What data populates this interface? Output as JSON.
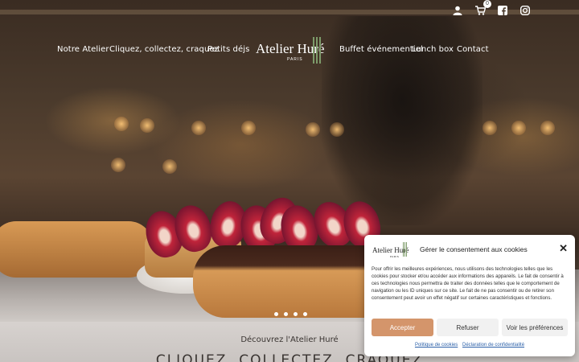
{
  "header": {
    "icons": [
      "user-icon",
      "cart-icon",
      "facebook-icon",
      "instagram-icon"
    ],
    "cart_count": "0"
  },
  "nav": {
    "items": [
      "Notre Atelier",
      "Cliquez, collectez, craquez",
      "Petits déjs",
      "Buffet événementiel",
      "Lunch box",
      "Contact"
    ],
    "logo_name": "Atelier Huré",
    "logo_city": "PARIS"
  },
  "slider": {
    "slide_count": 4,
    "active_index": 0
  },
  "section": {
    "subtitle": "Découvrez l'Atelier Huré",
    "title": "CLIQUEZ, COLLECTEZ, CRAQUEZ"
  },
  "cookie": {
    "logo_name": "Atelier Huré",
    "logo_city": "PARIS",
    "title": "Gérer le consentement aux cookies",
    "body": "Pour offrir les meilleures expériences, nous utilisons des technologies telles que les cookies pour stocker et/ou accéder aux informations des appareils. Le fait de consentir à ces technologies nous permettra de traiter des données telles que le comportement de navigation ou les ID uniques sur ce site. Le fait de ne pas consentir ou de retirer son consentement peut avoir un effet négatif sur certaines caractéristiques et fonctions.",
    "accept_label": "Accepter",
    "refuse_label": "Refuser",
    "prefs_label": "Voir les préférences",
    "link_cookies": "Politique de cookies",
    "link_privacy": "Déclaration de confidentialité",
    "accent_color": "#d4956b"
  }
}
